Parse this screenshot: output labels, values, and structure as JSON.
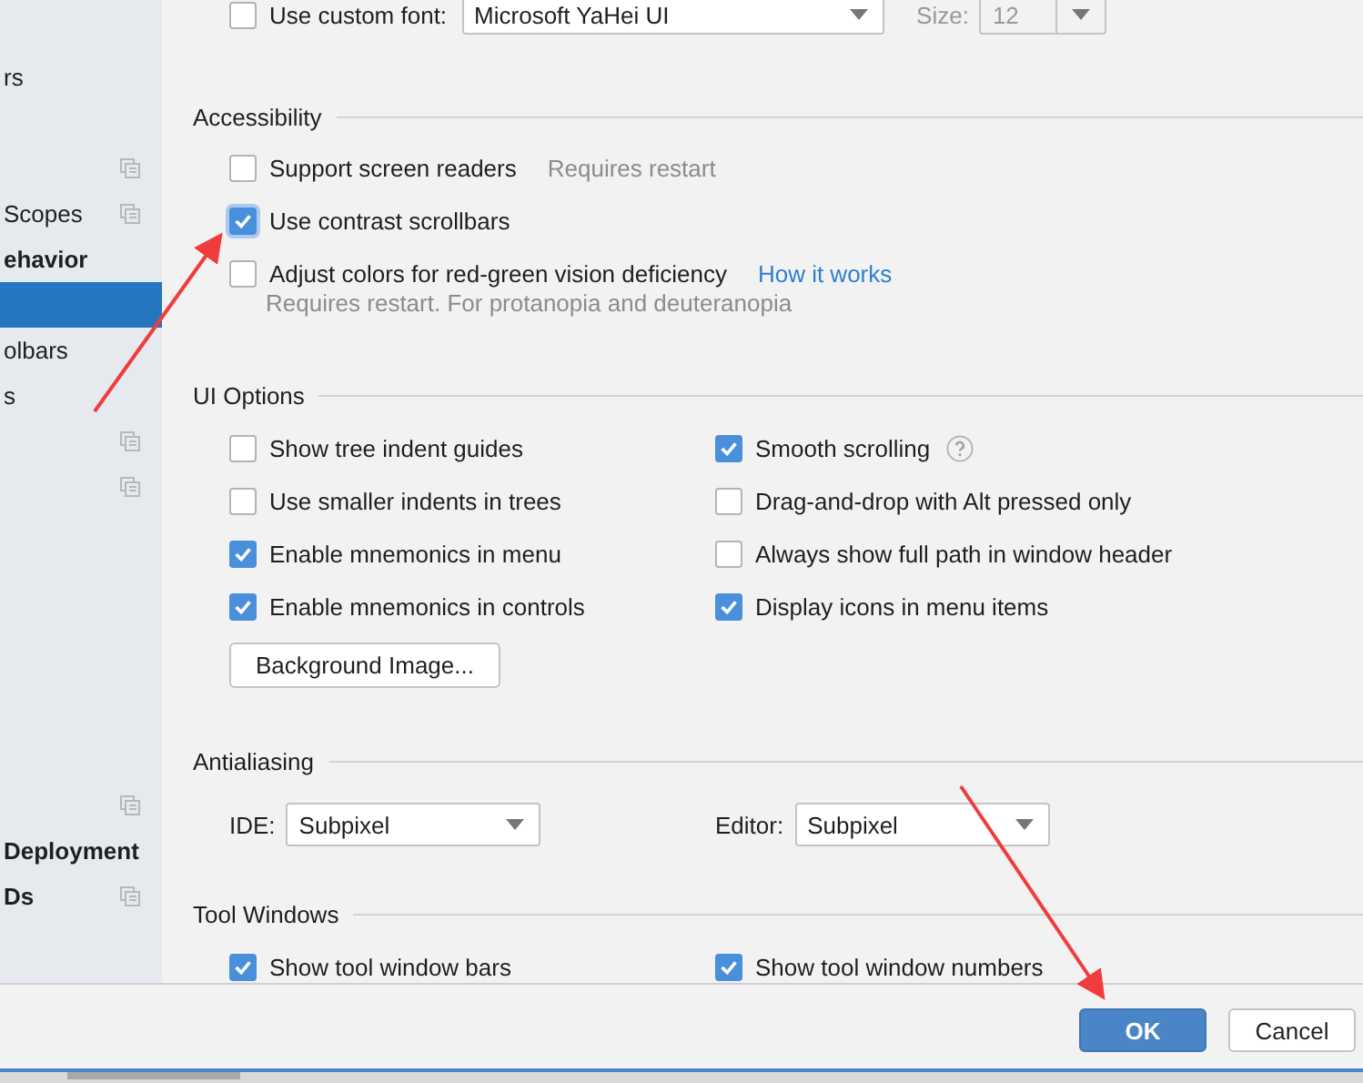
{
  "sidebar": {
    "items": [
      {
        "text": "rs",
        "bold": false,
        "icon": false,
        "selected": false
      },
      {
        "icon": true,
        "selected": false
      },
      {
        "text": "Scopes",
        "bold": false,
        "icon": true,
        "selected": false
      },
      {
        "text": "ehavior",
        "bold": true,
        "icon": false,
        "selected": false
      },
      {
        "icon": false,
        "selected": true
      },
      {
        "text": "olbars",
        "bold": false,
        "icon": false,
        "selected": false
      },
      {
        "text": "s",
        "bold": false,
        "icon": false,
        "selected": false
      },
      {
        "icon": true,
        "selected": false
      },
      {
        "icon": true,
        "selected": false
      }
    ],
    "bottom_items": [
      {
        "icon": true,
        "selected": false
      },
      {
        "text": "Deployment",
        "bold": true,
        "icon": false,
        "selected": false
      },
      {
        "text": "Ds",
        "bold": true,
        "icon": true,
        "selected": false
      }
    ]
  },
  "font_row": {
    "label": "Use custom font:",
    "checked": false,
    "font": "Microsoft YaHei UI",
    "size_label": "Size:",
    "size": "12",
    "disabled": true
  },
  "accessibility": {
    "title": "Accessibility",
    "options": [
      {
        "label": "Support screen readers",
        "checked": false,
        "note": "Requires restart"
      },
      {
        "label": "Use contrast scrollbars",
        "checked": true
      },
      {
        "label": "Adjust colors for red-green vision deficiency",
        "checked": false,
        "link": "How it works",
        "hint": "Requires restart. For protanopia and deuteranopia"
      }
    ]
  },
  "ui_options": {
    "title": "UI Options",
    "options": [
      {
        "label": "Show tree indent guides",
        "checked": false
      },
      {
        "label": "Smooth scrolling",
        "checked": true,
        "help": true
      },
      {
        "label": "Use smaller indents in trees",
        "checked": false
      },
      {
        "label": "Drag-and-drop with Alt pressed only",
        "checked": false
      },
      {
        "label": "Enable mnemonics in menu",
        "checked": true
      },
      {
        "label": "Always show full path in window header",
        "checked": false
      },
      {
        "label": "Enable mnemonics in controls",
        "checked": true
      },
      {
        "label": "Display icons in menu items",
        "checked": true
      }
    ],
    "button": "Background Image..."
  },
  "antialiasing": {
    "title": "Antialiasing",
    "fields": [
      {
        "label": "IDE:",
        "value": "Subpixel"
      },
      {
        "label": "Editor:",
        "value": "Subpixel"
      }
    ]
  },
  "tool_windows": {
    "title": "Tool Windows",
    "options": [
      {
        "label": "Show tool window bars",
        "checked": true
      },
      {
        "label": "Show tool window numbers",
        "checked": true
      }
    ]
  },
  "buttons": [
    {
      "label": "OK",
      "kind": "primary"
    },
    {
      "label": "Cancel",
      "kind": "secondary"
    }
  ]
}
